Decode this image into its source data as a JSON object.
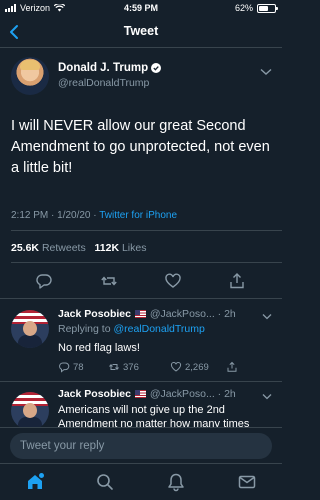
{
  "status_bar": {
    "carrier": "Verizon",
    "time": "4:59 PM",
    "battery_text": "62%",
    "battery_level": 0.62
  },
  "nav": {
    "title": "Tweet",
    "back_icon": "chevron-left-icon"
  },
  "main_tweet": {
    "author_name": "Donald J. Trump",
    "author_handle": "@realDonaldTrump",
    "text": "I will NEVER allow our great Second Amendment to go unprotected, not even a little bit!",
    "timestamp": "2:12 PM · 1/20/20 · ",
    "source": "Twitter for iPhone",
    "retweets_count": "25.6K",
    "retweets_label": "Retweets",
    "likes_count": "112K",
    "likes_label": "Likes",
    "actions": [
      "reply-icon",
      "retweet-icon",
      "like-icon",
      "share-icon"
    ]
  },
  "replies": [
    {
      "author_name": "Jack Posobiec",
      "author_handle": "@JackPoso... · 2h",
      "replying_prefix": "Replying to ",
      "replying_to": "@realDonaldTrump",
      "text": "No red flag laws!",
      "reply_count": "78",
      "retweet_count": "376",
      "like_count": "2,269"
    },
    {
      "author_name": "Jack Posobiec",
      "author_handle": "@JackPoso... · 2h",
      "text": "Americans will not give up the 2nd Amendment no matter how many times"
    }
  ],
  "compose": {
    "placeholder": "Tweet your reply"
  },
  "tab_bar": {
    "items": [
      "home-icon",
      "search-icon",
      "notifications-icon",
      "messages-icon"
    ]
  },
  "colors": {
    "background": "#15202b",
    "accent": "#1da1f2",
    "muted": "#8899a6",
    "divider": "#38444d"
  }
}
